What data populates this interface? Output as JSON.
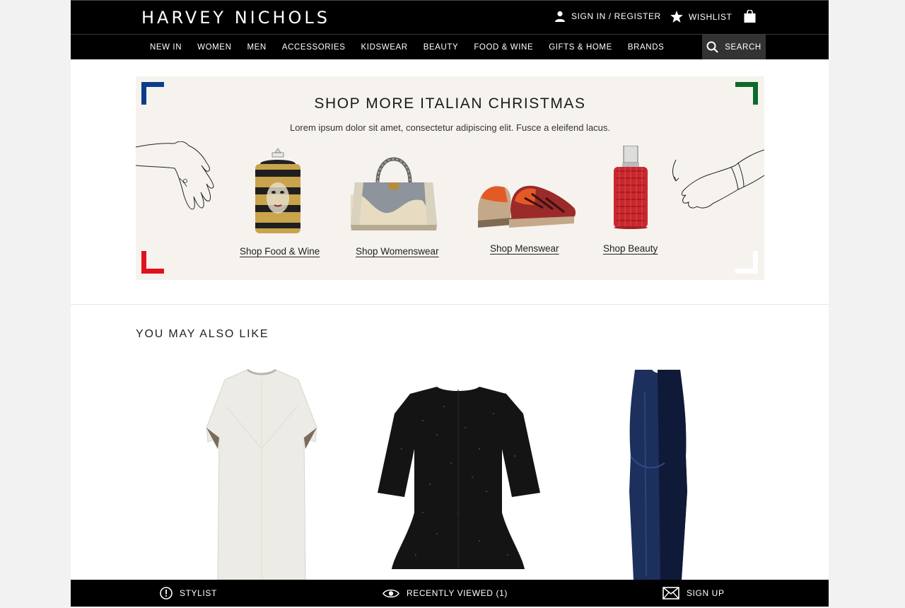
{
  "header": {
    "logo": "HARVEY NICHOLS",
    "sign_in": "SIGN IN / REGISTER",
    "wishlist": "WISHLIST"
  },
  "nav": {
    "items": [
      "NEW IN",
      "WOMEN",
      "MEN",
      "ACCESSORIES",
      "KIDSWEAR",
      "BEAUTY",
      "FOOD & WINE",
      "GIFTS & HOME",
      "BRANDS"
    ],
    "search": "SEARCH"
  },
  "banner": {
    "title": "SHOP MORE ITALIAN CHRISTMAS",
    "subtitle": "Lorem ipsum dolor sit amet, consectetur adipiscing elit. Fusce a eleifend lacus.",
    "links": [
      "Shop Food & Wine",
      "Shop Womenswear",
      "Shop Menswear",
      "Shop Beauty"
    ],
    "corner_colors": [
      "#0b3e8a",
      "#0c6b2c",
      "#e0121c",
      "#ffffff"
    ]
  },
  "recommendations": {
    "title": "YOU MAY ALSO LIKE",
    "items": [
      "ivory-dress",
      "black-sparkle-top",
      "navy-velvet-dress"
    ]
  },
  "footer": {
    "stylist": "STYLIST",
    "recent": "RECENTLY VIEWED (1)",
    "signup": "SIGN UP"
  }
}
